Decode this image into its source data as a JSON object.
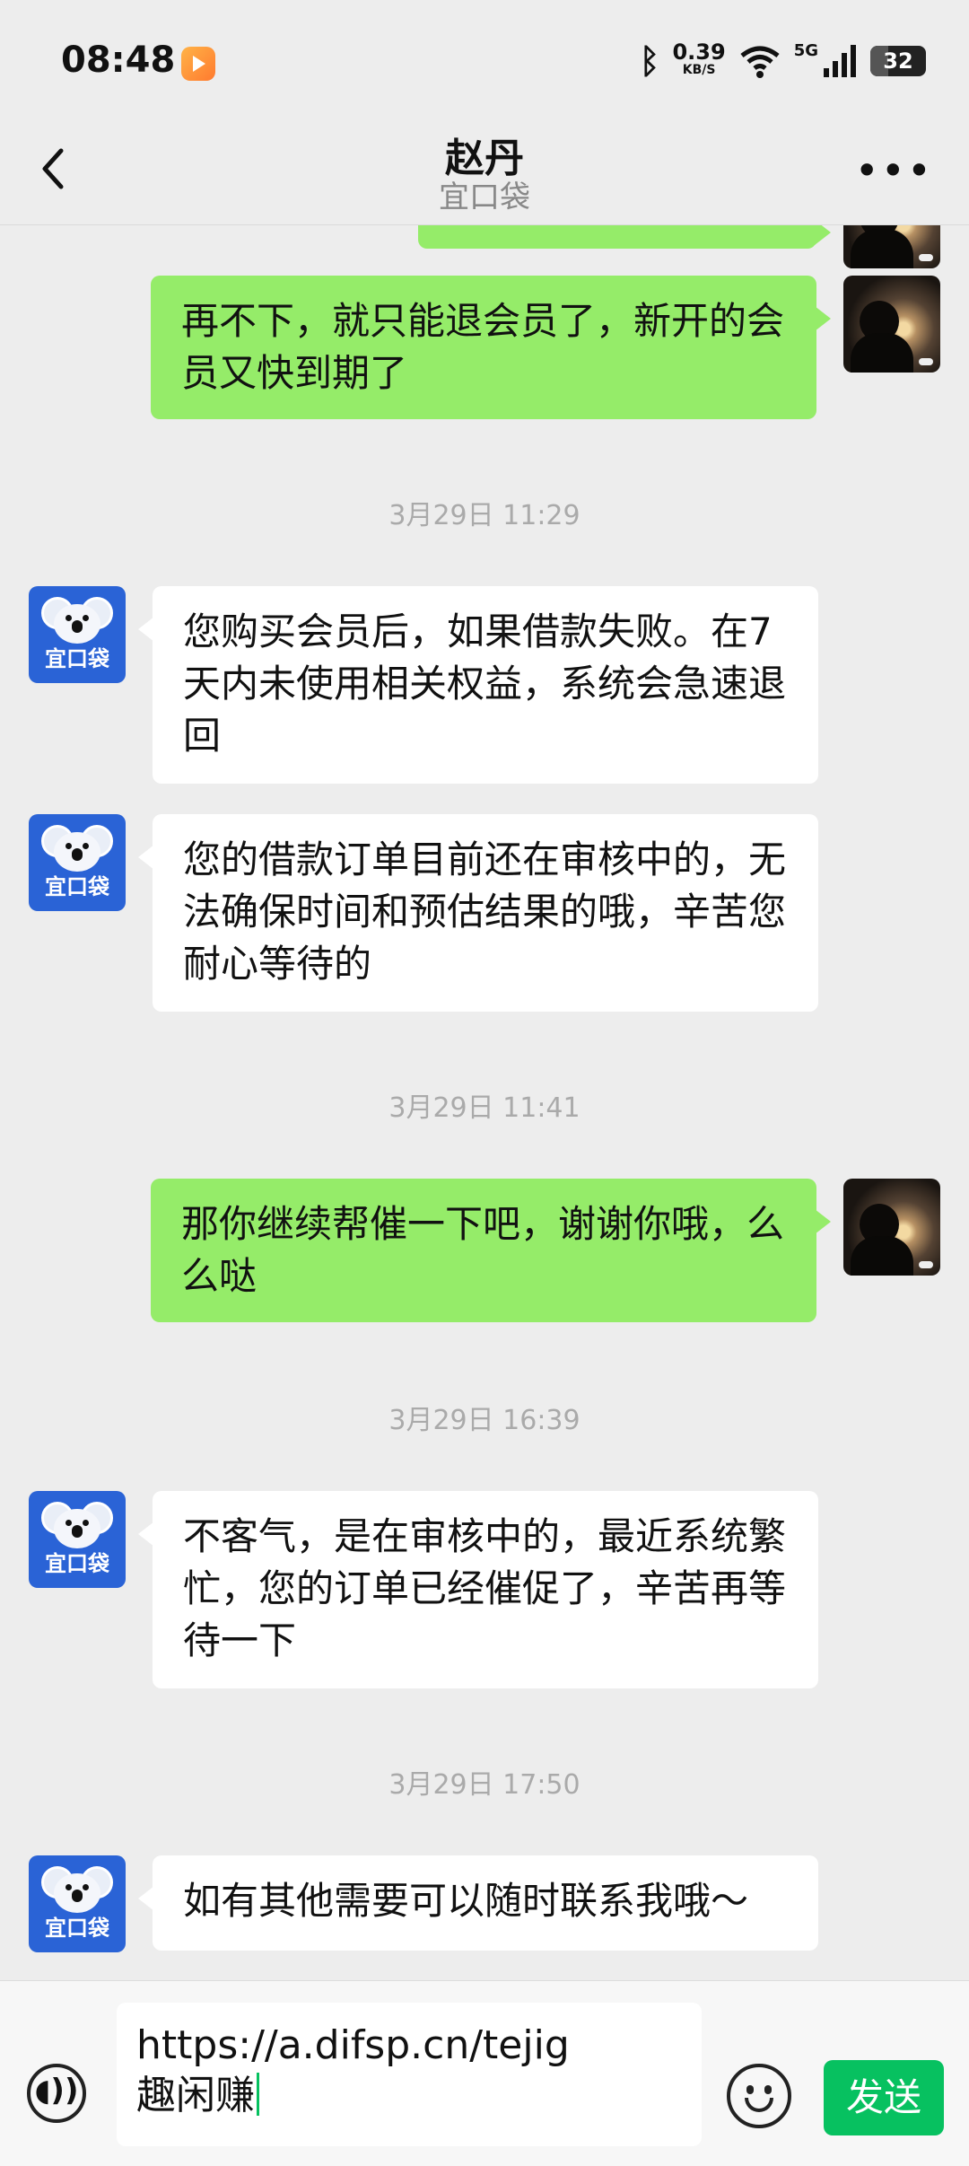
{
  "status_bar": {
    "time": "08:48",
    "net_speed": "0.39",
    "net_speed_unit": "KB/S",
    "network": "5G",
    "battery": "32",
    "battery_level": 0.32
  },
  "header": {
    "title": "赵丹",
    "subtitle": "宜口袋"
  },
  "bot_label": "宜口袋",
  "messages": [
    {
      "type": "out",
      "text": ""
    },
    {
      "type": "out",
      "text": "再不下，就只能退会员了，新开的会员又快到期了"
    },
    {
      "type": "time",
      "text": "3月29日 11:29"
    },
    {
      "type": "in",
      "text": "您购买会员后，如果借款失败。在7天内未使用相关权益，系统会急速退回"
    },
    {
      "type": "in",
      "text": "您的借款订单目前还在审核中的，无法确保时间和预估结果的哦，辛苦您耐心等待的"
    },
    {
      "type": "time",
      "text": "3月29日 11:41"
    },
    {
      "type": "out",
      "text": "那你继续帮催一下吧，谢谢你哦，么么哒"
    },
    {
      "type": "time",
      "text": "3月29日 16:39"
    },
    {
      "type": "in",
      "text": "不客气，是在审核中的，最近系统繁忙，您的订单已经催促了，辛苦再等待一下"
    },
    {
      "type": "time",
      "text": "3月29日 17:50"
    },
    {
      "type": "in",
      "text": "如有其他需要可以随时联系我哦～"
    }
  ],
  "input": {
    "line1": "https://a.difsp.cn/tejig",
    "line2": "趣闲赚"
  },
  "send_label": "发送",
  "colors": {
    "outgoing_bubble": "#95ec69",
    "incoming_bubble": "#ffffff",
    "send_button": "#07c160",
    "background": "#ededed",
    "bot_avatar": "#2a63d6"
  },
  "icons": {
    "back": "chevron-left-icon",
    "more": "more-dots-icon",
    "voice": "voice-icon",
    "emoji": "emoji-icon"
  }
}
